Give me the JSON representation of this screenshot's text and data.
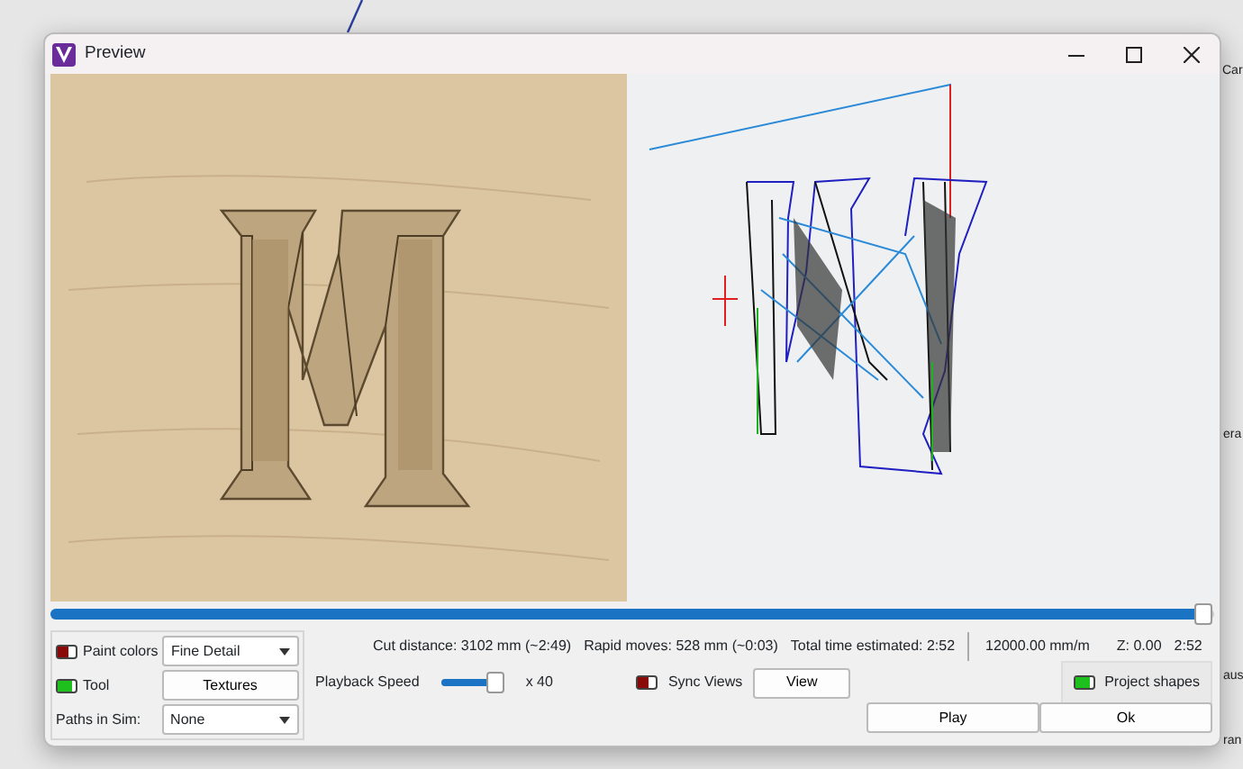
{
  "window": {
    "title": "Preview"
  },
  "background_texts": [
    "Car",
    "era",
    "aus",
    "ran"
  ],
  "progress": {
    "level": 0.99
  },
  "options": [
    {
      "kind": "toggle-select",
      "label": "Paint colors",
      "on": false,
      "value": "Fine Detail"
    },
    {
      "kind": "toggle-button",
      "label": "Tool",
      "on": true,
      "button": "Textures"
    },
    {
      "kind": "select",
      "label": "Paths in Sim:",
      "value": "None"
    }
  ],
  "stats": {
    "cut_distance": "Cut distance: 3102 mm (~2:49)",
    "rapid_moves": "Rapid moves: 528 mm (~0:03)",
    "total_time": "Total time estimated: 2:52",
    "feed_rate": "12000.00 mm/m",
    "z": "Z: 0.00",
    "time": "2:52"
  },
  "playback": {
    "label": "Playback Speed",
    "level": 0.85,
    "reading": "x 40"
  },
  "sync_views": {
    "label": "Sync Views",
    "on": false
  },
  "view_button": "View",
  "project_shapes": {
    "label": "Project shapes",
    "on": true
  },
  "buttons": [
    "Play",
    "Ok"
  ]
}
